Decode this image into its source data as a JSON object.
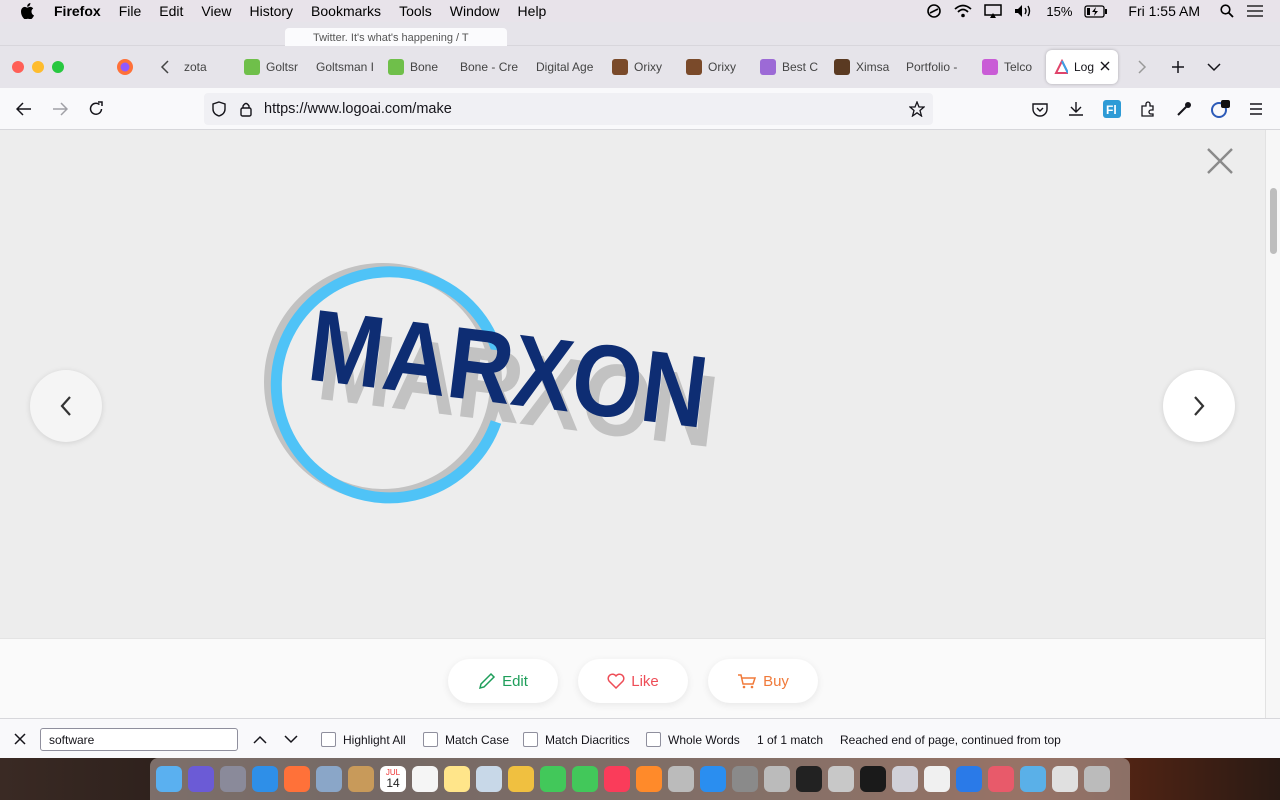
{
  "menubar": {
    "app": "Firefox",
    "items": [
      "File",
      "Edit",
      "View",
      "History",
      "Bookmarks",
      "Tools",
      "Window",
      "Help"
    ],
    "battery": "15%",
    "clock": "Fri 1:55 AM"
  },
  "ghost_tab": {
    "title": "Twitter. It's what's happening / T"
  },
  "tabs": [
    {
      "label": "zota",
      "color": "#b9b9bd"
    },
    {
      "label": "Goltsr",
      "color": "#6fbf4a"
    },
    {
      "label": "Goltsman I",
      "color": "#b9b9bd"
    },
    {
      "label": "Bone",
      "color": "#6fbf4a"
    },
    {
      "label": "Bone - Cre",
      "color": "#b9b9bd"
    },
    {
      "label": "Digital Age",
      "color": "#b9b9bd"
    },
    {
      "label": "Orixy",
      "color": "#7a4a2a"
    },
    {
      "label": "Orixy",
      "color": "#7a4a2a"
    },
    {
      "label": "Best C",
      "color": "#9c6ad6"
    },
    {
      "label": "Ximsa",
      "color": "#5a3a22"
    },
    {
      "label": "Portfolio -",
      "color": "#b9b9bd"
    },
    {
      "label": "Telco",
      "color": "#c95cd6"
    }
  ],
  "active_tab": {
    "label": "Log"
  },
  "navbar": {
    "url": "https://www.logoai.com/make"
  },
  "logo": {
    "text": "MARXON",
    "ring_color": "#4fc3f7",
    "text_color": "#0e2d73",
    "shadow_color": "#c2c2c2"
  },
  "actions": {
    "edit": {
      "label": "Edit",
      "color": "#1e9e5a"
    },
    "like": {
      "label": "Like",
      "color": "#ee4d57"
    },
    "buy": {
      "label": "Buy",
      "color": "#f07a3a"
    }
  },
  "findbar": {
    "query": "software",
    "options": [
      "Highlight All",
      "Match Case",
      "Match Diacritics",
      "Whole Words"
    ],
    "match_count": "1 of 1 match",
    "status": "Reached end of page, continued from top"
  },
  "dock": {
    "calendar_month": "JUL",
    "calendar_day": "14",
    "icons": [
      "finder-icon",
      "siri-icon",
      "launchpad-icon",
      "safari-icon",
      "firefox-icon",
      "preview-icon",
      "contacts-icon",
      "calendar-icon",
      "reminders-icon",
      "notes-icon",
      "photo-booth-icon",
      "photos-icon",
      "messages-icon",
      "facetime-icon",
      "music-icon",
      "books-icon",
      "help-icon",
      "app-store-icon",
      "system-preferences-icon",
      "help-icon",
      "terminal-icon",
      "screenshot-icon",
      "activity-monitor-icon",
      "disk-utility-icon",
      "textedit-icon",
      "vscode-icon",
      "database-icon",
      "folder-icon",
      "window-icon",
      "trash-icon"
    ]
  }
}
